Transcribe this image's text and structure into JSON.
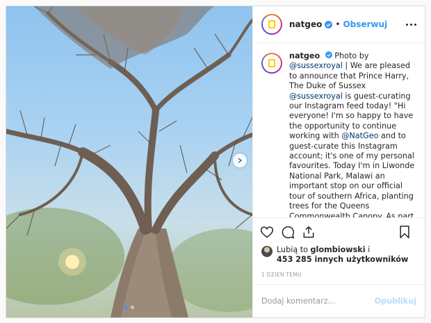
{
  "post": {
    "username": "natgeo",
    "verified": true,
    "follow_label": "Obserwuj",
    "avatar_text": "NATIONAL GEOGRAPHIC",
    "carousel": {
      "slides": 2,
      "active": 1
    }
  },
  "caption": {
    "username": "natgeo",
    "parts": [
      {
        "t": "Photo by "
      },
      {
        "m": "@sussexroyal"
      },
      {
        "t": " | We are pleased to announce that Prince Harry, The Duke of Sussex "
      },
      {
        "m": "@sussexroyal"
      },
      {
        "t": " is guest-curating our Instagram feed today! \"Hi everyone! I'm so happy to have the opportunity to continue working with "
      },
      {
        "m": "@NatGeo"
      },
      {
        "t": " and to guest-curate this Instagram account; it's one of my personal favourites. Today I'm in Liwonde National Park, Malawi an important stop on our official tour of southern Africa, planting trees for the Queens Commonwealth Canopy. As part of this takeover, I am inviting you to be a part of our 'Looking Up' social campaign. To help launch the campaign, here is a photograph I took today here in Liwonde of Baobab trees."
      }
    ]
  },
  "likes": {
    "prefix": "Lubią to ",
    "user": "glombiowski",
    "middle": " i",
    "count_text": "453 285 innych użytkowników"
  },
  "timestamp": "1 DZIEŃ TEMU",
  "comment": {
    "placeholder": "Dodaj komentarz...",
    "publish_label": "Opublikuj"
  },
  "colors": {
    "link": "#3897f0",
    "mention": "#003569",
    "publish_disabled": "#b2dffc"
  },
  "icons": [
    "verified-badge-icon",
    "more-options-icon",
    "heart-icon",
    "comment-icon",
    "share-icon",
    "bookmark-icon",
    "chevron-right-icon"
  ]
}
